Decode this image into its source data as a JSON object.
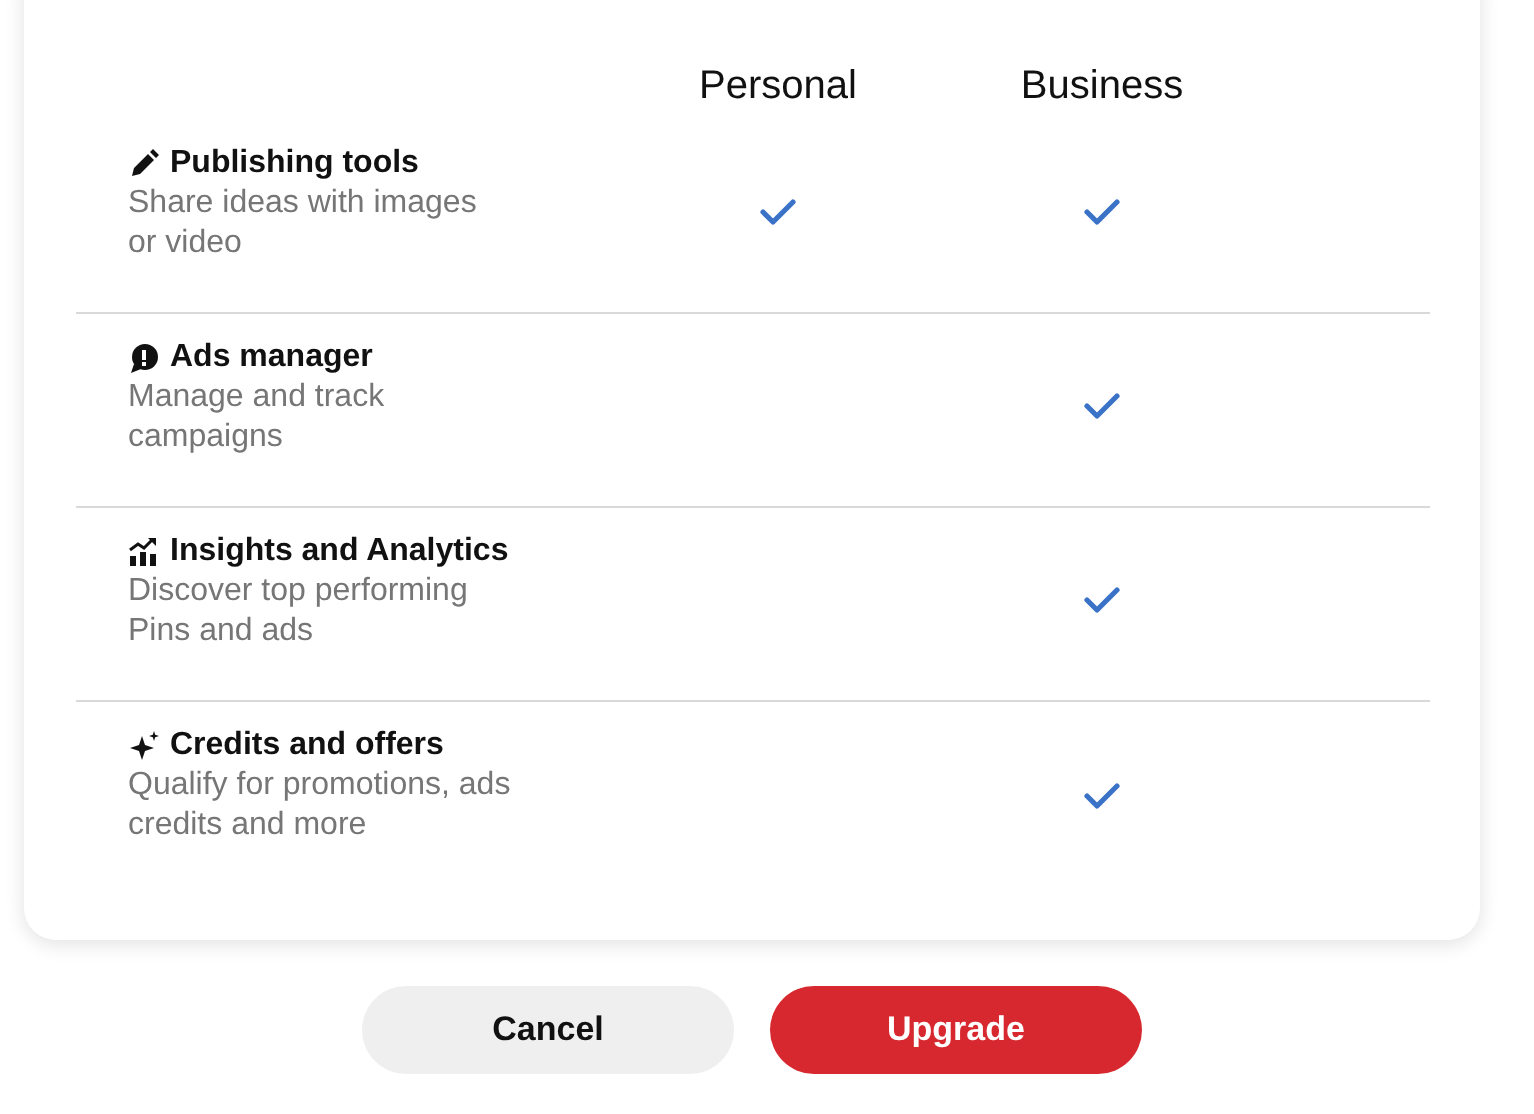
{
  "plans": [
    "Personal",
    "Business"
  ],
  "features": [
    {
      "kind": "pencil",
      "title": "Publishing tools",
      "description": "Share ideas with images or video",
      "included": [
        true,
        true
      ]
    },
    {
      "kind": "bubble",
      "title": "Ads manager",
      "description": "Manage and track campaigns",
      "included": [
        false,
        true
      ]
    },
    {
      "kind": "chart",
      "title": "Insights and Analytics",
      "description": "Discover top performing Pins and ads",
      "included": [
        false,
        true
      ]
    },
    {
      "kind": "sparkle",
      "title": "Credits and offers",
      "description": "Qualify for promotions, ads credits and more",
      "included": [
        false,
        true
      ]
    }
  ],
  "buttons": [
    {
      "label": "Cancel",
      "kind": "secondary"
    },
    {
      "label": "Upgrade",
      "kind": "primary"
    }
  ]
}
